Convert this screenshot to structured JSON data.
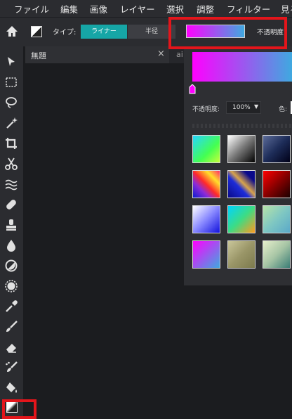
{
  "menu": [
    "ファイル",
    "編集",
    "画像",
    "レイヤー",
    "選択",
    "調整",
    "フィルター",
    "見る"
  ],
  "toolbar": {
    "type_label": "タイプ:",
    "type_options": [
      "ライナー",
      "半径"
    ],
    "selected_type": "ライナー",
    "opacity_label": "不透明度"
  },
  "tabs": {
    "active": "無題",
    "next": "ai"
  },
  "panel": {
    "opacity_label": "不透明度:",
    "opacity_value": "100%",
    "color_label": "色:",
    "swatch_count": 12
  },
  "colors": {
    "accent": "#16a6a6",
    "highlight": "#e3151b",
    "gradient_start": "#ff00ff",
    "gradient_end": "#3fa9e0"
  },
  "icons": [
    "home-icon",
    "gradient-icon",
    "move-icon",
    "marquee-icon",
    "lasso-icon",
    "magic-wand-icon",
    "crop-icon",
    "scissors-icon",
    "liquify-icon",
    "healing-icon",
    "stamp-icon",
    "blur-icon",
    "dodge-icon",
    "sponge-icon",
    "eyedropper-icon",
    "brush-icon",
    "eraser-icon",
    "replace-color-icon",
    "paint-bucket-icon",
    "gradient-tool-icon"
  ]
}
